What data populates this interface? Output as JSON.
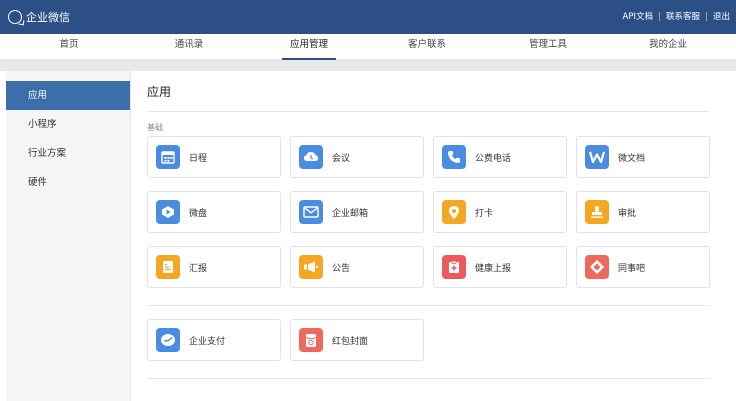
{
  "header": {
    "brand": "企业微信",
    "links": [
      "API文档",
      "联系客服",
      "退出"
    ]
  },
  "nav": {
    "items": [
      "首页",
      "通讯录",
      "应用管理",
      "客户联系",
      "管理工具",
      "我的企业"
    ],
    "active": "应用管理"
  },
  "sidebar": {
    "items": [
      "应用",
      "小程序",
      "行业方案",
      "硬件"
    ],
    "active": "应用"
  },
  "main": {
    "title": "应用",
    "section_label": "基础"
  },
  "apps": [
    {
      "label": "日程",
      "icon": "calendar-icon",
      "color": "#4a8ce0"
    },
    {
      "label": "会议",
      "icon": "meeting-icon",
      "color": "#4a8ce0"
    },
    {
      "label": "公费电话",
      "icon": "phone-icon",
      "color": "#4a8ce0"
    },
    {
      "label": "微文档",
      "icon": "document-w-icon",
      "color": "#4a8ce0"
    },
    {
      "label": "微盘",
      "icon": "drive-icon",
      "color": "#4a8ce0"
    },
    {
      "label": "企业邮箱",
      "icon": "mail-icon",
      "color": "#4a8ce0"
    },
    {
      "label": "打卡",
      "icon": "location-pin-icon",
      "color": "#f5a623"
    },
    {
      "label": "审批",
      "icon": "stamp-icon",
      "color": "#f5a623"
    },
    {
      "label": "汇报",
      "icon": "report-icon",
      "color": "#f5a623"
    },
    {
      "label": "公告",
      "icon": "megaphone-icon",
      "color": "#f5a623"
    },
    {
      "label": "健康上报",
      "icon": "health-report-icon",
      "color": "#ec5b5b"
    },
    {
      "label": "同事吧",
      "icon": "colleague-forum-icon",
      "color": "#ec6a5b"
    },
    {
      "label": "企业支付",
      "icon": "payment-icon",
      "color": "#4a8ce0"
    },
    {
      "label": "红包封面",
      "icon": "red-envelope-icon",
      "color": "#ec6a5b"
    }
  ]
}
